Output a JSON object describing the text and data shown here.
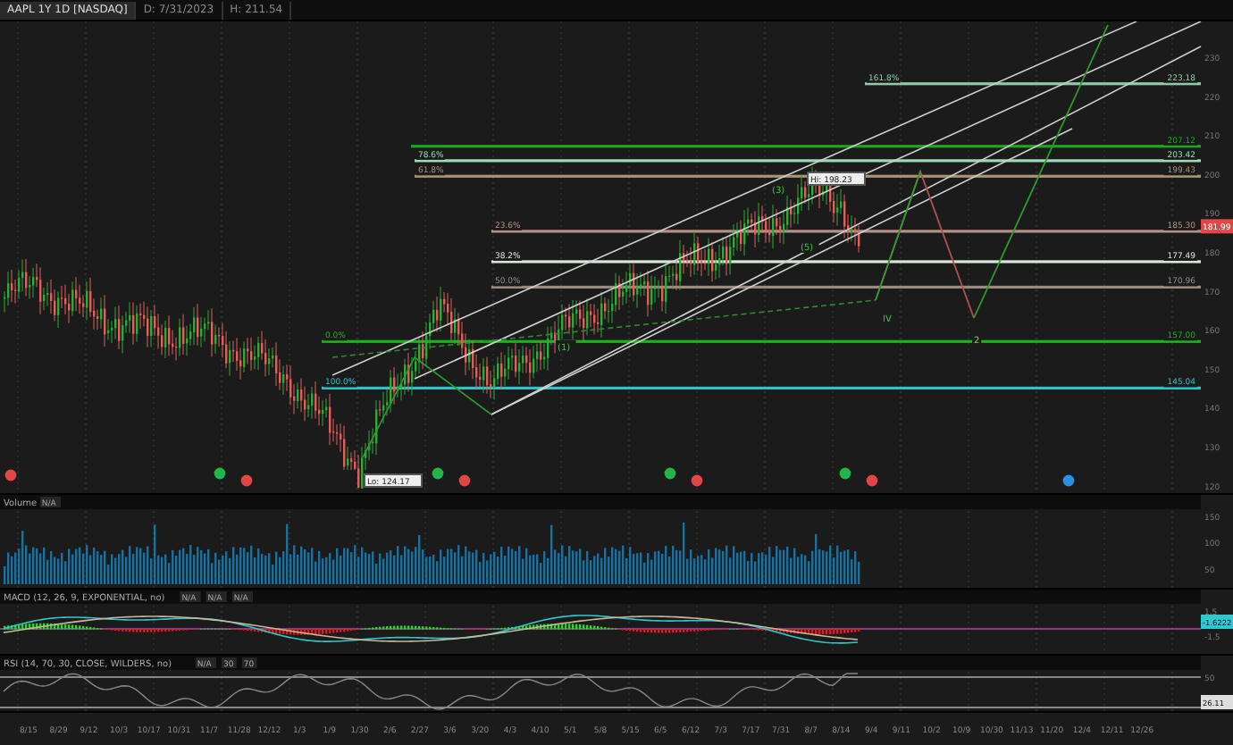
{
  "header": {
    "symbol": "AAPL 1Y 1D [NASDAQ]",
    "date": "D: 7/31/2023",
    "price": "H: 211.54"
  },
  "price_chart": {
    "axis_ticks": [
      "230",
      "220",
      "210",
      "200",
      "190",
      "180",
      "170",
      "160",
      "150",
      "140",
      "130",
      "120"
    ],
    "fib_levels": [
      {
        "pct": "161.8%",
        "price": "223.18",
        "color": "#8fc9a8"
      },
      {
        "price": "207.12",
        "color": "#1fa51f"
      },
      {
        "pct": "78.6%",
        "price": "203.42",
        "color": "#9fd9b8"
      },
      {
        "pct": "61.8%",
        "price": "199.43",
        "color": "#a89276"
      },
      {
        "pct": "23.6%",
        "price": "185.30",
        "color": "#b89088"
      },
      {
        "pct": "38.2%",
        "price": "177.49",
        "color": "#d8e8d8"
      },
      {
        "pct": "50.0%",
        "price": "170.96",
        "color": "#9a8a80"
      },
      {
        "pct": "0.0%",
        "price": "157.00",
        "color": "#1fb01f"
      },
      {
        "pct": "100.0%",
        "price": "145.04",
        "color": "#30c0c8"
      }
    ],
    "hi_label": "Hi: 198.23",
    "lo_label": "Lo: 124.17",
    "last_price": "181.99",
    "wave_labels": [
      "(1)",
      "(3)",
      "(5)",
      "IV",
      "2"
    ]
  },
  "studies": [
    {
      "kind": "volume",
      "title": "Volume",
      "values": [
        "N/A"
      ],
      "axis_ticks": [
        "150",
        "100",
        "50"
      ]
    },
    {
      "kind": "macd",
      "title": "MACD (12, 26, 9, EXPONENTIAL, no)",
      "values": [
        "N/A",
        "N/A",
        "N/A"
      ],
      "axis_ticks": [
        "1.5",
        "-1.5"
      ],
      "badge": "-1.6222"
    },
    {
      "kind": "rsi",
      "title": "RSI (14, 70, 30, CLOSE, WILDERS, no)",
      "values": [
        "N/A",
        "30",
        "70"
      ],
      "axis_ticks": [
        "50"
      ],
      "badge": "26.11"
    }
  ],
  "date_axis": [
    "8/15",
    "8/29",
    "9/12",
    "10/3",
    "10/17",
    "10/31",
    "11/7",
    "11/28",
    "12/12",
    "1/3",
    "1/9",
    "1/30",
    "2/6",
    "2/27",
    "3/6",
    "3/20",
    "4/3",
    "4/10",
    "5/1",
    "5/8",
    "5/15",
    "6/5",
    "6/12",
    "7/3",
    "7/17",
    "7/31",
    "8/7",
    "8/14",
    "9/4",
    "9/11",
    "10/2",
    "10/9",
    "10/30",
    "11/13",
    "11/20",
    "12/4",
    "12/11",
    "12/26"
  ]
}
